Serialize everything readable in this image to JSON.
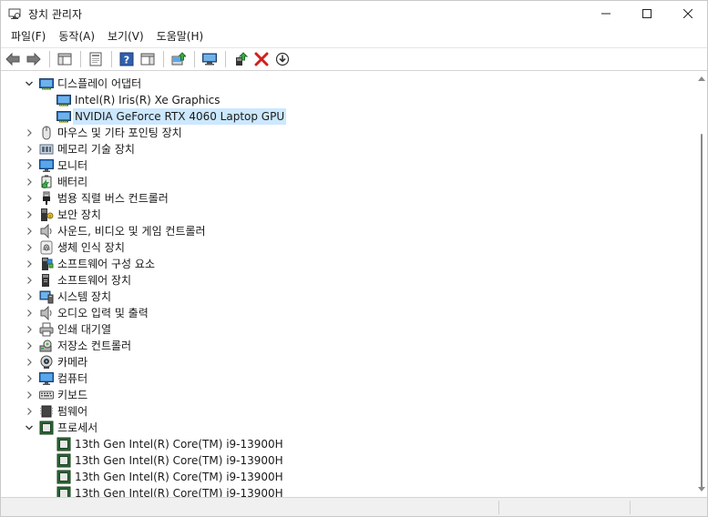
{
  "window": {
    "title": "장치 관리자"
  },
  "menu": [
    {
      "label": "파일(F)"
    },
    {
      "label": "동작(A)"
    },
    {
      "label": "보기(V)"
    },
    {
      "label": "도움말(H)"
    }
  ],
  "toolbar": [
    {
      "icon": "back-arrow-icon"
    },
    {
      "icon": "forward-arrow-icon"
    },
    {
      "sep": true
    },
    {
      "icon": "show-hide-tree-icon"
    },
    {
      "sep": true
    },
    {
      "icon": "properties-icon"
    },
    {
      "sep": true
    },
    {
      "icon": "help-icon"
    },
    {
      "icon": "action-pane-icon"
    },
    {
      "sep": true
    },
    {
      "icon": "update-driver-icon"
    },
    {
      "sep": true
    },
    {
      "icon": "scan-hardware-icon"
    },
    {
      "sep": true
    },
    {
      "icon": "enable-device-icon"
    },
    {
      "icon": "uninstall-device-icon"
    },
    {
      "icon": "download-driver-icon"
    }
  ],
  "tree": [
    {
      "label": "디스플레이 어댑터",
      "level": 0,
      "expanded": true,
      "icon": "display-adapter-icon"
    },
    {
      "label": "Intel(R) Iris(R) Xe Graphics",
      "level": 1,
      "icon": "display-adapter-icon"
    },
    {
      "label": "NVIDIA GeForce RTX 4060 Laptop GPU",
      "level": 1,
      "icon": "display-adapter-icon",
      "selected": true
    },
    {
      "label": "마우스 및 기타 포인팅 장치",
      "level": 0,
      "expanded": false,
      "icon": "mouse-icon"
    },
    {
      "label": "메모리 기술 장치",
      "level": 0,
      "expanded": false,
      "icon": "memory-device-icon"
    },
    {
      "label": "모니터",
      "level": 0,
      "expanded": false,
      "icon": "monitor-icon"
    },
    {
      "label": "배터리",
      "level": 0,
      "expanded": false,
      "icon": "battery-icon"
    },
    {
      "label": "범용 직렬 버스 컨트롤러",
      "level": 0,
      "expanded": false,
      "icon": "usb-icon"
    },
    {
      "label": "보안 장치",
      "level": 0,
      "expanded": false,
      "icon": "security-device-icon"
    },
    {
      "label": "사운드, 비디오 및 게임 컨트롤러",
      "level": 0,
      "expanded": false,
      "icon": "speaker-icon"
    },
    {
      "label": "생체 인식 장치",
      "level": 0,
      "expanded": false,
      "icon": "fingerprint-icon"
    },
    {
      "label": "소프트웨어 구성 요소",
      "level": 0,
      "expanded": false,
      "icon": "software-component-icon"
    },
    {
      "label": "소프트웨어 장치",
      "level": 0,
      "expanded": false,
      "icon": "software-device-icon"
    },
    {
      "label": "시스템 장치",
      "level": 0,
      "expanded": false,
      "icon": "system-device-icon"
    },
    {
      "label": "오디오 입력 및 출력",
      "level": 0,
      "expanded": false,
      "icon": "speaker-icon"
    },
    {
      "label": "인쇄 대기열",
      "level": 0,
      "expanded": false,
      "icon": "printer-icon"
    },
    {
      "label": "저장소 컨트롤러",
      "level": 0,
      "expanded": false,
      "icon": "storage-controller-icon"
    },
    {
      "label": "카메라",
      "level": 0,
      "expanded": false,
      "icon": "camera-icon"
    },
    {
      "label": "컴퓨터",
      "level": 0,
      "expanded": false,
      "icon": "computer-icon"
    },
    {
      "label": "키보드",
      "level": 0,
      "expanded": false,
      "icon": "keyboard-icon"
    },
    {
      "label": "펌웨어",
      "level": 0,
      "expanded": false,
      "icon": "firmware-icon"
    },
    {
      "label": "프로세서",
      "level": 0,
      "expanded": true,
      "icon": "processor-icon"
    },
    {
      "label": "13th Gen Intel(R) Core(TM) i9-13900H",
      "level": 1,
      "icon": "processor-icon"
    },
    {
      "label": "13th Gen Intel(R) Core(TM) i9-13900H",
      "level": 1,
      "icon": "processor-icon"
    },
    {
      "label": "13th Gen Intel(R) Core(TM) i9-13900H",
      "level": 1,
      "icon": "processor-icon"
    },
    {
      "label": "13th Gen Intel(R) Core(TM) i9-13900H",
      "level": 1,
      "icon": "processor-icon"
    }
  ]
}
